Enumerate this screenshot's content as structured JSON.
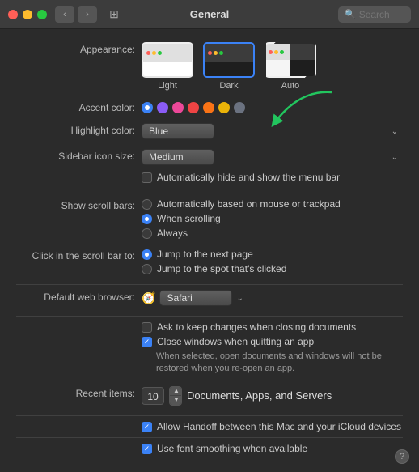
{
  "titlebar": {
    "title": "General",
    "search_placeholder": "Search"
  },
  "appearance": {
    "label": "Appearance:",
    "options": [
      {
        "id": "light",
        "label": "Light"
      },
      {
        "id": "dark",
        "label": "Dark"
      },
      {
        "id": "auto",
        "label": "Auto"
      }
    ],
    "selected": "auto"
  },
  "accent_color": {
    "label": "Accent color:",
    "colors": [
      "#3b82f6",
      "#8b5cf6",
      "#ec4899",
      "#ef4444",
      "#f97316",
      "#eab308",
      "#6b7280"
    ],
    "selected": 0
  },
  "highlight_color": {
    "label": "Highlight color:",
    "value": "Blue"
  },
  "sidebar_icon_size": {
    "label": "Sidebar icon size:",
    "value": "Medium"
  },
  "menu_bar": {
    "label": "",
    "text": "Automatically hide and show the menu bar",
    "checked": false
  },
  "show_scroll_bars": {
    "label": "Show scroll bars:",
    "options": [
      {
        "id": "auto",
        "label": "Automatically based on mouse or trackpad"
      },
      {
        "id": "scrolling",
        "label": "When scrolling"
      },
      {
        "id": "always",
        "label": "Always"
      }
    ],
    "selected": "scrolling"
  },
  "click_scroll_bar": {
    "label": "Click in the scroll bar to:",
    "options": [
      {
        "id": "next_page",
        "label": "Jump to the next page"
      },
      {
        "id": "spot_clicked",
        "label": "Jump to the spot that's clicked"
      }
    ],
    "selected": "next_page"
  },
  "default_browser": {
    "label": "Default web browser:",
    "value": "Safari"
  },
  "checkboxes": {
    "ask_keep_changes": {
      "label": "Ask to keep changes when closing documents",
      "checked": false
    },
    "close_windows": {
      "label": "Close windows when quitting an app",
      "checked": true
    },
    "close_windows_note": "When selected, open documents and windows will not be restored when you re-open an app."
  },
  "recent_items": {
    "label": "Recent items:",
    "value": "10",
    "suffix": "Documents, Apps, and Servers"
  },
  "allow_handoff": {
    "label": "Allow Handoff between this Mac and your iCloud devices",
    "checked": true
  },
  "font_smoothing": {
    "label": "Use font smoothing when available",
    "checked": true
  },
  "help": "?"
}
